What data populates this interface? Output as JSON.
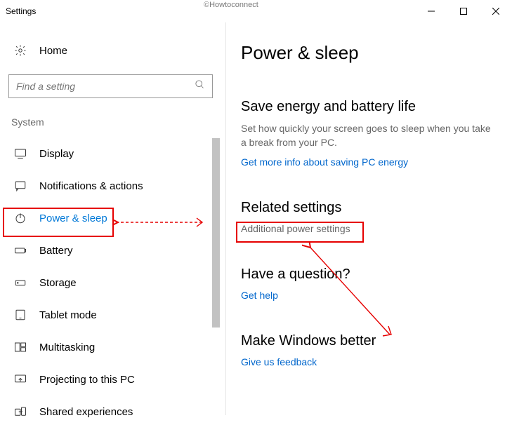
{
  "window": {
    "title": "Settings",
    "watermark": "©Howtoconnect"
  },
  "sidebar": {
    "home_label": "Home",
    "search_placeholder": "Find a setting",
    "section_label": "System",
    "items": [
      {
        "icon": "display-icon",
        "label": "Display"
      },
      {
        "icon": "notifications-icon",
        "label": "Notifications & actions"
      },
      {
        "icon": "power-icon",
        "label": "Power & sleep",
        "selected": true
      },
      {
        "icon": "battery-icon",
        "label": "Battery"
      },
      {
        "icon": "storage-icon",
        "label": "Storage"
      },
      {
        "icon": "tablet-icon",
        "label": "Tablet mode"
      },
      {
        "icon": "multitask-icon",
        "label": "Multitasking"
      },
      {
        "icon": "project-icon",
        "label": "Projecting to this PC"
      },
      {
        "icon": "shared-icon",
        "label": "Shared experiences"
      }
    ]
  },
  "content": {
    "title": "Power & sleep",
    "section1": {
      "heading": "Save energy and battery life",
      "body": "Set how quickly your screen goes to sleep when you take a break from your PC.",
      "link": "Get more info about saving PC energy"
    },
    "section2": {
      "heading": "Related settings",
      "link": "Additional power settings"
    },
    "section3": {
      "heading": "Have a question?",
      "link": "Get help"
    },
    "section4": {
      "heading": "Make Windows better",
      "link": "Give us feedback"
    }
  },
  "annotations": {
    "highlight_color": "#e60000"
  }
}
